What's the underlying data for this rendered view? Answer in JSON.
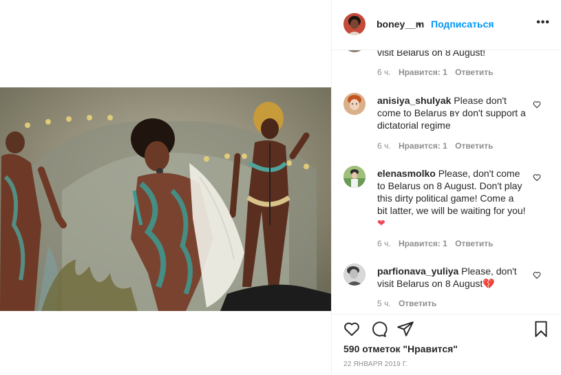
{
  "post": {
    "username": "boney__m",
    "separator": "•",
    "follow_label": "Подписаться",
    "more_label": "•••",
    "likes_text": "590 отметок \"Нравится\"",
    "date_text": "22 ЯНВАРЯ 2019 Г."
  },
  "comments": [
    {
      "username": "",
      "text": "visit Belarus on 8 August!",
      "time": "6 ч.",
      "likes": "Нравится: 1",
      "reply": "Ответить"
    },
    {
      "username": "anisiya_shulyak",
      "text": "Please don't come to Belarus ʙʏ don't support a dictatorial regime",
      "time": "6 ч.",
      "likes": "Нравится: 1",
      "reply": "Ответить"
    },
    {
      "username": "elenasmolko",
      "text": "Please, don't come to Belarus on 8 August. Don't play this dirty political game! Come a bit latter, we will be waiting for you!",
      "time": "6 ч.",
      "likes": "Нравится: 1",
      "reply": "Ответить"
    },
    {
      "username": "parfionava_yuliya",
      "text": "Please, don't visit Belarus on 8 August",
      "time": "5 ч.",
      "likes": "",
      "reply": "Ответить"
    }
  ],
  "emoji": {
    "heart": "❤",
    "broken_heart": "💔"
  },
  "icons": {
    "more": "more-options-icon",
    "like": "heart-icon",
    "comment": "comment-icon",
    "share": "share-icon",
    "save": "bookmark-icon",
    "comment_like": "small-heart-icon"
  },
  "colors": {
    "link": "#0095f6",
    "text": "#262626",
    "muted": "#8e8e8e",
    "border": "#efefef",
    "emoji_red": "#ed4956"
  }
}
